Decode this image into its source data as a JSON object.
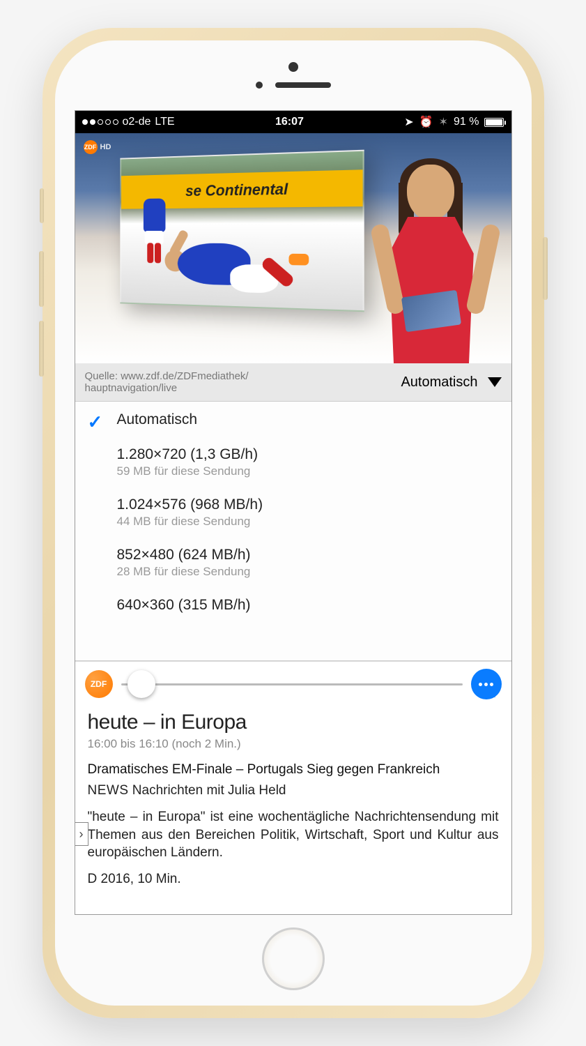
{
  "status_bar": {
    "carrier": "o2-de",
    "network": "LTE",
    "time": "16:07",
    "battery_pct": "91 %"
  },
  "channel_logo_text": "ZDF",
  "channel_badge_suffix": "HD",
  "ad_text": "se  Continental",
  "source": {
    "label_line1": "Quelle: www.zdf.de/ZDFmediathek/",
    "label_line2": "hauptnavigation/live",
    "dropdown_selected": "Automatisch"
  },
  "quality": {
    "selected_index": 0,
    "options": [
      {
        "title": "Automatisch",
        "sub": ""
      },
      {
        "title": "1.280×720 (1,3 GB/h)",
        "sub": "59 MB für diese Sendung"
      },
      {
        "title": "1.024×576 (968 MB/h)",
        "sub": "44 MB für diese Sendung"
      },
      {
        "title": "852×480 (624 MB/h)",
        "sub": "28 MB für diese Sendung"
      },
      {
        "title": "640×360 (315 MB/h)",
        "sub": ""
      }
    ]
  },
  "program": {
    "logo_text": "ZDF",
    "title": "heute – in Europa",
    "time": "16:00 bis 16:10 (noch 2 Min.)",
    "headline": "Dramatisches EM-Finale – Portugals Sieg gegen Frankreich",
    "category": "NEWS",
    "category_detail": "Nachrichten mit Julia Held",
    "description": "\"heute – in Europa\" ist eine wochentägliche Nachrichtensendung mit Themen aus den Bereichen Politik, Wirtschaft, Sport und Kultur aus europäischen Ländern.",
    "meta": "D 2016, 10 Min."
  },
  "expand_glyph": "›"
}
